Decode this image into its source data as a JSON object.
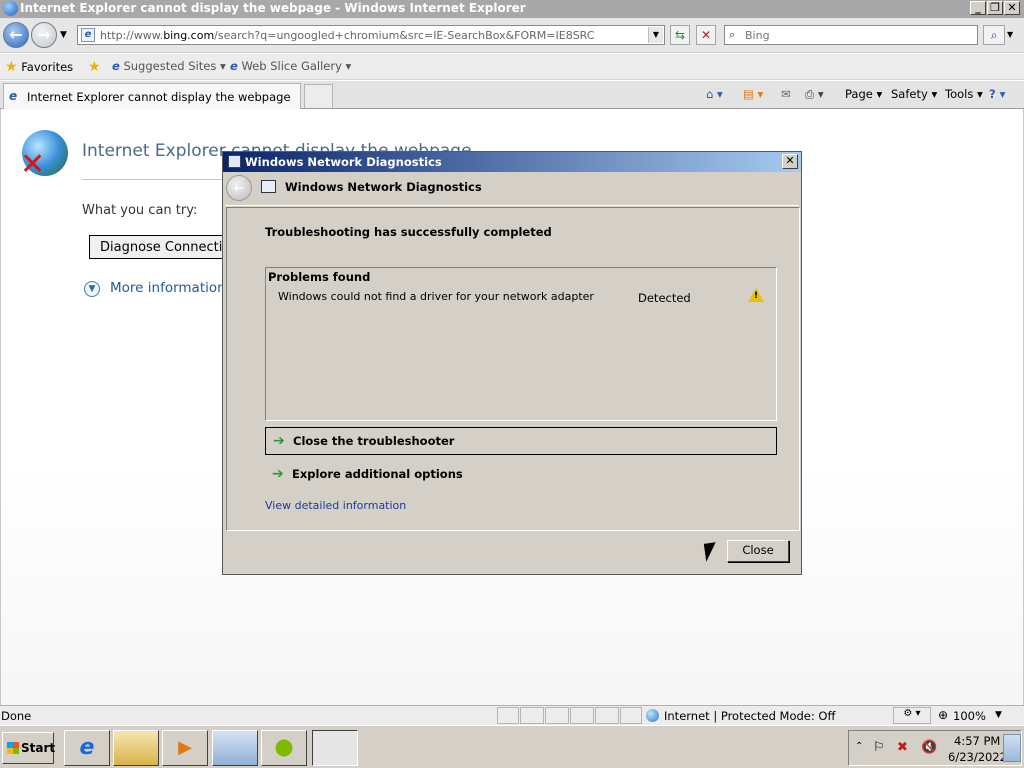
{
  "window": {
    "title": "Internet Explorer cannot display the webpage - Windows Internet Explorer",
    "minimize_glyph": "_",
    "maximize_glyph": "❐",
    "close_glyph": "✕"
  },
  "addressbar": {
    "url_prefix": "http://www.",
    "url_domain": "bing.com",
    "url_rest": "/search?q=ungoogled+chromium&src=IE-SearchBox&FORM=IE8SRC",
    "search_placeholder": "Bing"
  },
  "favorites": {
    "favorites_label": "Favorites",
    "suggested_sites": "Suggested Sites",
    "web_slice_gallery": "Web Slice Gallery"
  },
  "tabs": [
    {
      "label": "Internet Explorer cannot display the webpage"
    }
  ],
  "commandbar": {
    "page": "Page",
    "safety": "Safety",
    "tools": "Tools"
  },
  "errorpage": {
    "title": "Internet Explorer cannot display the webpage",
    "what_you_can_try": "What you can try:",
    "diagnose_button": "Diagnose Connection Problems",
    "more_information": "More information"
  },
  "dialog": {
    "title": "Windows Network Diagnostics",
    "header": "Windows Network Diagnostics",
    "status_heading": "Troubleshooting has successfully completed",
    "problems_header": "Problems found",
    "problems": [
      {
        "text": "Windows could not find a driver for your network adapter",
        "status": "Detected"
      }
    ],
    "options": [
      {
        "label": "Close the troubleshooter"
      },
      {
        "label": "Explore additional options"
      }
    ],
    "view_details": "View detailed information",
    "close_button": "Close"
  },
  "statusbar": {
    "status": "Done",
    "zone": "Internet | Protected Mode: Off",
    "zoom": "100%"
  },
  "taskbar": {
    "start_label": "Start",
    "pinned": [
      "internet-explorer-icon",
      "file-explorer-icon",
      "media-player-icon",
      "network-center-icon",
      "windows-logo-icon",
      "network-diagnostics-icon"
    ],
    "clock_time": "4:57 PM",
    "clock_date": "6/23/2022"
  },
  "colors": {
    "dialog_title_start": "#0a246a",
    "dialog_title_end": "#a6caf0",
    "link": "#1a3c9a",
    "warning": "#e8c200"
  }
}
